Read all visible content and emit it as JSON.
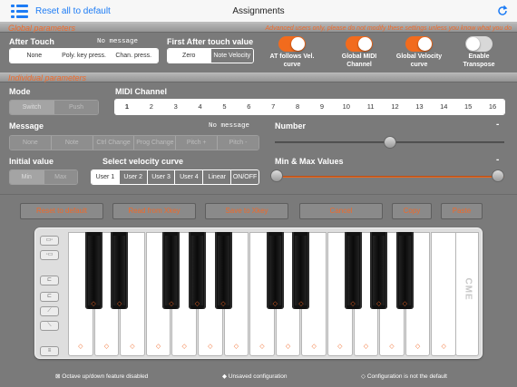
{
  "header": {
    "reset_all_label": "Reset all to default",
    "title": "Assignments"
  },
  "global": {
    "title": "Global parameters",
    "note": "Advanced users only, please do not modify these settings unless you know what you do",
    "after_touch": {
      "label": "After Touch",
      "value": "No message",
      "options": [
        "None",
        "Poly. key press.",
        "Chan. press."
      ],
      "selected": 0
    },
    "first_after_touch": {
      "label": "First After touch value",
      "options": [
        "Zero",
        "Note Velocity"
      ],
      "selected": 1
    },
    "toggles": [
      {
        "label_line1": "AT follows Vel.",
        "label_line2": "curve",
        "on": true
      },
      {
        "label_line1": "Global MIDI",
        "label_line2": "Channel",
        "on": true
      },
      {
        "label_line1": "Global Velocity",
        "label_line2": "curve",
        "on": true
      },
      {
        "label_line1": "Enable",
        "label_line2": "Transpose",
        "on": false
      }
    ]
  },
  "individual": {
    "title": "Individual parameters",
    "mode": {
      "label": "Mode",
      "options": [
        "Switch",
        "Push"
      ]
    },
    "midi_channel": {
      "label": "MIDI Channel",
      "options": [
        "1",
        "2",
        "3",
        "4",
        "5",
        "6",
        "7",
        "8",
        "9",
        "10",
        "11",
        "12",
        "13",
        "14",
        "15",
        "16"
      ],
      "selected": 0
    },
    "message": {
      "label": "Message",
      "value": "No message",
      "options": [
        "None",
        "Note",
        "Ctrl Change",
        "Prog Change",
        "Pitch +",
        "Pitch -"
      ]
    },
    "number": {
      "label": "Number",
      "value": "-",
      "slider_fraction": 0.5
    },
    "initial_value": {
      "label": "Initial value",
      "options": [
        "Min",
        "Max"
      ]
    },
    "velocity_curve": {
      "label": "Select velocity curve",
      "options": [
        "User 1",
        "User 2",
        "User 3",
        "User 4",
        "Linear",
        "ON/OFF"
      ],
      "selected": 0
    },
    "min_max": {
      "label": "Min & Max Values",
      "value": "-"
    }
  },
  "actions": [
    "Reset to default",
    "Read from Xkey",
    "Save to Xkey",
    "Cancel",
    "Copy",
    "Paste"
  ],
  "keyboard": {
    "logo": "CME",
    "white_key_count": 15,
    "black_key_count": 10,
    "key_marker": "◇"
  },
  "footer": {
    "octave_note": "Octave up/down feature disabled",
    "octave_icon": "⊠",
    "unsaved_icon": "◆",
    "unsaved_note": "Unsaved configuration",
    "default_icon": "◇",
    "default_note": "Configuration is not the default"
  },
  "colors": {
    "accent": "#f26b1d",
    "ios_blue": "#1d7cf5",
    "background": "#7a7a7a"
  }
}
